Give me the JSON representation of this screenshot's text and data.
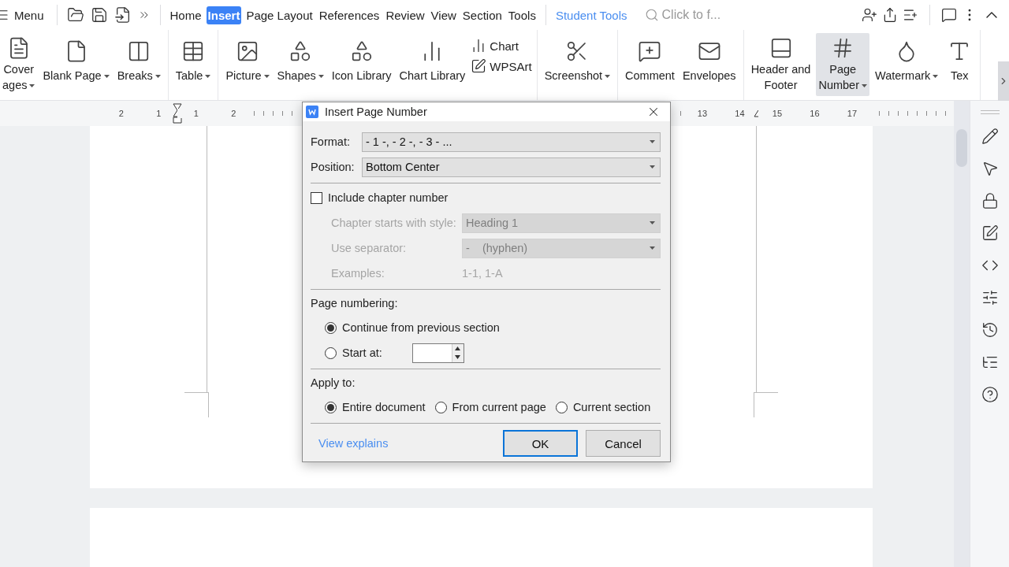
{
  "menu_bar": {
    "menu_label": "Menu",
    "tabs": [
      {
        "label": "Home",
        "selected": false
      },
      {
        "label": "Insert",
        "selected": true
      },
      {
        "label": "Page Layout",
        "selected": false
      },
      {
        "label": "References",
        "selected": false
      },
      {
        "label": "Review",
        "selected": false
      },
      {
        "label": "View",
        "selected": false
      },
      {
        "label": "Section",
        "selected": false
      },
      {
        "label": "Tools",
        "selected": false
      }
    ],
    "student_tools": "Student Tools",
    "search": {
      "placeholder": "Click to f..."
    }
  },
  "ribbon": {
    "groups": [
      [
        {
          "kind": "large",
          "lines": [
            "Cover",
            "ages"
          ],
          "dropdown": true,
          "selected": false
        },
        {
          "kind": "large",
          "lines": [
            "Blank Page"
          ],
          "dropdown": true,
          "selected": false
        },
        {
          "kind": "large",
          "lines": [
            "Breaks"
          ],
          "dropdown": true,
          "selected": false
        }
      ],
      [
        {
          "kind": "large",
          "lines": [
            "Table"
          ],
          "dropdown": true,
          "selected": false
        }
      ],
      [
        {
          "kind": "large",
          "lines": [
            "Picture"
          ],
          "dropdown": true,
          "selected": false
        },
        {
          "kind": "large",
          "lines": [
            "Shapes"
          ],
          "dropdown": true,
          "selected": false
        },
        {
          "kind": "large",
          "lines": [
            "Icon Library"
          ],
          "dropdown": false,
          "selected": false
        },
        {
          "kind": "large",
          "lines": [
            "Chart Library"
          ],
          "dropdown": false,
          "selected": false
        },
        {
          "kind": "small",
          "lines": [
            "Chart",
            "WPSArt"
          ]
        }
      ],
      [
        {
          "kind": "large",
          "lines": [
            "Screenshot"
          ],
          "dropdown": true,
          "selected": false
        }
      ],
      [
        {
          "kind": "large",
          "lines": [
            "Comment"
          ],
          "dropdown": false,
          "selected": false
        },
        {
          "kind": "large",
          "lines": [
            "Envelopes"
          ],
          "dropdown": false,
          "selected": false
        }
      ],
      [
        {
          "kind": "large",
          "lines": [
            "Header and",
            "Footer"
          ],
          "dropdown": false,
          "selected": false
        },
        {
          "kind": "large",
          "lines": [
            "Page",
            "Number"
          ],
          "dropdown": true,
          "selected": true
        },
        {
          "kind": "large",
          "lines": [
            "Watermark"
          ],
          "dropdown": true,
          "selected": false
        },
        {
          "kind": "large",
          "lines": [
            "Tex"
          ],
          "dropdown": false,
          "selected": false
        }
      ]
    ]
  },
  "ruler": {
    "left_labels": [
      "2",
      "1",
      "1",
      "2"
    ],
    "right_labels": [
      "13",
      "14",
      "15",
      "16",
      "17"
    ]
  },
  "dialog": {
    "title": "Insert Page Number",
    "format": {
      "label": "Format:",
      "value": "- 1 -, - 2 -, - 3 - ..."
    },
    "position": {
      "label": "Position:",
      "value": "Bottom Center"
    },
    "include_chapter": {
      "label": "Include chapter number",
      "checked": false
    },
    "chapter_rows": [
      {
        "kind": "select",
        "label": "Chapter starts with style:",
        "value": "Heading 1",
        "disabled": true
      },
      {
        "kind": "select",
        "label": "Use separator:",
        "value": "-    (hyphen)",
        "disabled": true
      },
      {
        "kind": "text",
        "label": "Examples:",
        "value": "1-1, 1-A",
        "disabled": true
      }
    ],
    "page_numbering": {
      "label": "Page numbering:",
      "options": [
        {
          "label": "Continue from previous section",
          "selected": true
        },
        {
          "label": "Start at:",
          "selected": false
        }
      ]
    },
    "apply_to": {
      "label": "Apply to:",
      "options": [
        {
          "label": "Entire document",
          "selected": true
        },
        {
          "label": "From current page",
          "selected": false
        },
        {
          "label": "Current section",
          "selected": false
        }
      ]
    },
    "link": "View explains",
    "buttons": [
      {
        "label": "OK",
        "focused": true
      },
      {
        "label": "Cancel",
        "focused": false
      }
    ]
  }
}
